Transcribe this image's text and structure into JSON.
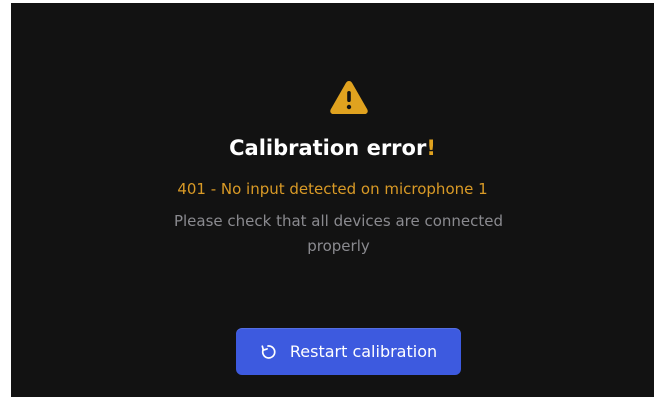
{
  "dialog": {
    "title": "Calibration error",
    "title_emphasis": "!",
    "error_code_text": "401 - No input detected on microphone 1",
    "message": "Please check that all devices are connected properly",
    "icon": "warning-triangle-icon"
  },
  "actions": {
    "restart_label": "Restart calibration",
    "restart_icon": "refresh-icon"
  },
  "colors": {
    "background": "#121212",
    "accent_warning": "#e0a21f",
    "button_blue": "#3d5adf",
    "message_gray": "#8a8a8f"
  }
}
